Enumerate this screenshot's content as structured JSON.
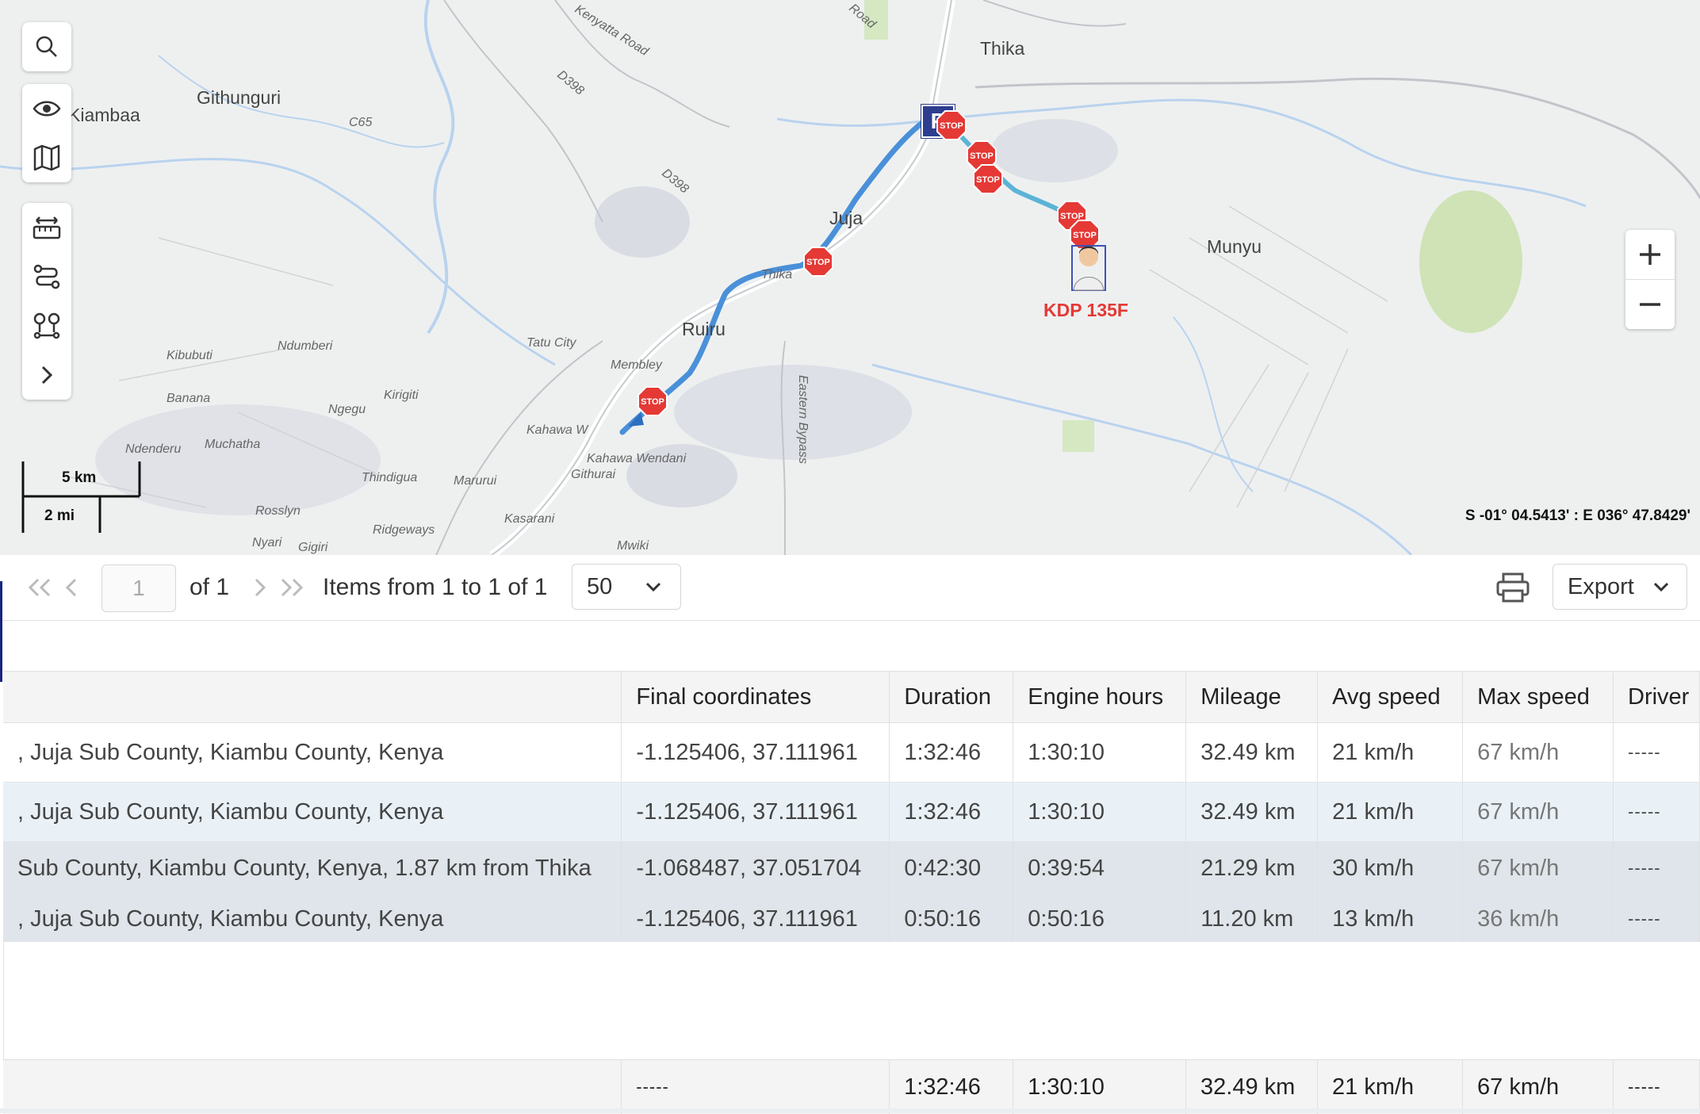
{
  "map": {
    "places": [
      {
        "name": "Thika"
      },
      {
        "name": "Githunguri"
      },
      {
        "name": "Kiambaa"
      },
      {
        "name": "Juja"
      },
      {
        "name": "Ruiru"
      },
      {
        "name": "Munyu"
      },
      {
        "name": "Thika"
      }
    ],
    "small_places": [
      {
        "name": "Kenyatta Road"
      },
      {
        "name": "D398"
      },
      {
        "name": "D398"
      },
      {
        "name": "C65"
      },
      {
        "name": "Kibubuti"
      },
      {
        "name": "Ndumberi"
      },
      {
        "name": "Tatu City"
      },
      {
        "name": "Membley"
      },
      {
        "name": "Banana"
      },
      {
        "name": "Ngegu"
      },
      {
        "name": "Kirigiti"
      },
      {
        "name": "Muchatha"
      },
      {
        "name": "Ndenderu"
      },
      {
        "name": "Kahawa W"
      },
      {
        "name": "Kahawa Wendani"
      },
      {
        "name": "Eastern Bypass"
      },
      {
        "name": "Thindigua"
      },
      {
        "name": "Marurui"
      },
      {
        "name": "Rosslyn"
      },
      {
        "name": "Ridgeways"
      },
      {
        "name": "Kasarani"
      },
      {
        "name": "Nyari"
      },
      {
        "name": "Gigiri"
      },
      {
        "name": "Mwiki"
      },
      {
        "name": "Road"
      },
      {
        "name": "Githurai"
      }
    ],
    "vehicle_label": "KDP 135F",
    "parking_label": "P",
    "stop_label": "STOP",
    "scale_km": "5 km",
    "scale_mi": "2 mi",
    "coordinate_readout": "S -01° 04.5413' : E 036° 47.8429'",
    "route_color": "#4a90d9",
    "stop_color": "#e53935",
    "controls": [
      "search-icon",
      "eye-icon",
      "map-icon",
      "ruler-icon",
      "route-icon",
      "geofence-icon",
      "chevron-right-icon"
    ],
    "zoom": {
      "in": "+",
      "out": "−"
    }
  },
  "toolbar": {
    "page_value": "1",
    "of_label": "of 1",
    "items_label": "Items from 1 to 1 of 1",
    "page_size": "50",
    "export_label": "Export"
  },
  "table": {
    "headers": [
      "",
      "Final coordinates",
      "Duration",
      "Engine hours",
      "Mileage",
      "Avg speed",
      "Max speed",
      "Driver"
    ],
    "rows": [
      [
        ", Juja Sub County, Kiambu County, Kenya",
        "-1.125406, 37.111961",
        "1:32:46",
        "1:30:10",
        "32.49 km",
        "21 km/h",
        "67 km/h",
        "-----"
      ],
      [
        ", Juja Sub County, Kiambu County, Kenya",
        "-1.125406, 37.111961",
        "1:32:46",
        "1:30:10",
        "32.49 km",
        "21 km/h",
        "67 km/h",
        "-----"
      ],
      [
        "Sub County, Kiambu County, Kenya, 1.87 km from Thika",
        "-1.068487, 37.051704",
        "0:42:30",
        "0:39:54",
        "21.29 km",
        "30 km/h",
        "67 km/h",
        "-----"
      ],
      [
        ", Juja Sub County, Kiambu County, Kenya",
        "-1.125406, 37.111961",
        "0:50:16",
        "0:50:16",
        "11.20 km",
        "13 km/h",
        "36 km/h",
        "-----"
      ]
    ],
    "totals": [
      "",
      "-----",
      "1:32:46",
      "1:30:10",
      "32.49 km",
      "21 km/h",
      "67 km/h",
      "-----"
    ]
  }
}
